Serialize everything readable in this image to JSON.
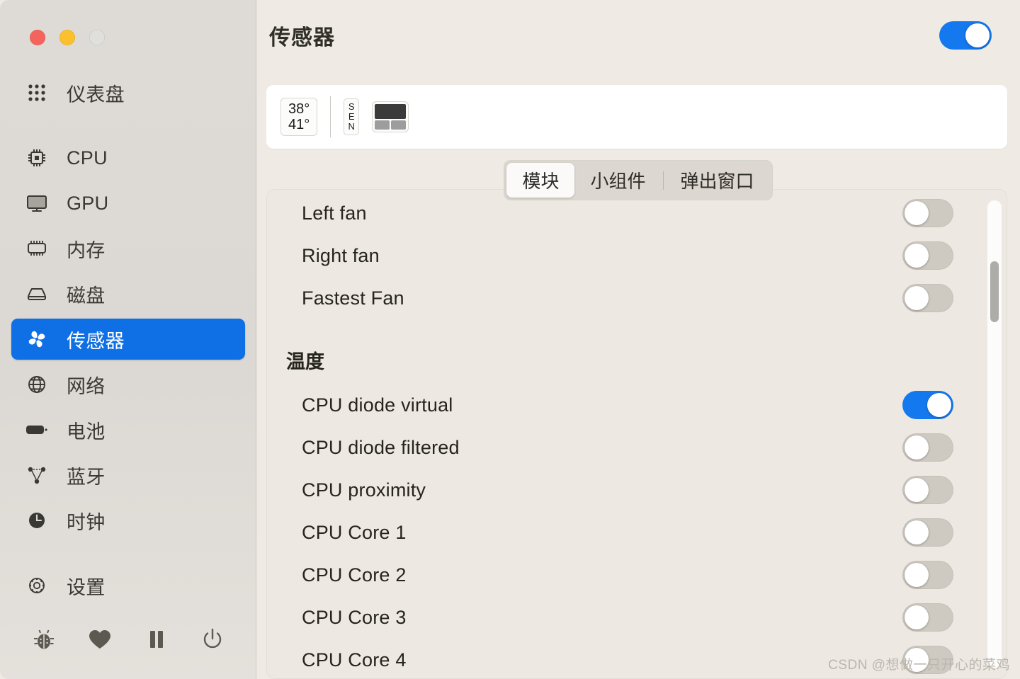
{
  "window": {
    "traffic_lights": [
      {
        "name": "close",
        "color": "#F4635C"
      },
      {
        "name": "minimize",
        "color": "#FBC02D"
      },
      {
        "name": "zoom",
        "color": "#DFDFDC"
      }
    ]
  },
  "sidebar": {
    "items": [
      {
        "label": "仪表盘",
        "icon": "dashboard-grid-icon",
        "selected": false
      },
      {
        "label": "CPU",
        "icon": "cpu-chip-icon",
        "selected": false
      },
      {
        "label": "GPU",
        "icon": "monitor-icon",
        "selected": false
      },
      {
        "label": "内存",
        "icon": "memory-chip-icon",
        "selected": false
      },
      {
        "label": "磁盘",
        "icon": "disk-icon",
        "selected": false
      },
      {
        "label": "传感器",
        "icon": "fan-icon",
        "selected": true
      },
      {
        "label": "网络",
        "icon": "globe-icon",
        "selected": false
      },
      {
        "label": "电池",
        "icon": "battery-icon",
        "selected": false
      },
      {
        "label": "蓝牙",
        "icon": "bluetooth-nodes-icon",
        "selected": false
      },
      {
        "label": "时钟",
        "icon": "clock-icon",
        "selected": false
      },
      {
        "label": "设置",
        "icon": "gear-icon",
        "selected": false
      }
    ],
    "tools": [
      {
        "name": "report-bug-icon"
      },
      {
        "name": "heart-icon"
      },
      {
        "name": "pause-icon"
      },
      {
        "name": "power-icon"
      }
    ]
  },
  "header": {
    "title": "传感器",
    "master_toggle": {
      "state": "on",
      "color": "#1478EE"
    }
  },
  "preview": {
    "temperature_lines": [
      "38°",
      "41°"
    ],
    "sen_label_letters": [
      "S",
      "E",
      "N"
    ],
    "block_widget": {
      "name": "bar-chart-widget",
      "top_color": "#3B3B3B",
      "cell_color": "#9D9D9D"
    }
  },
  "tabs": [
    {
      "label": "模块",
      "active": true
    },
    {
      "label": "小组件",
      "active": false
    },
    {
      "label": "弹出窗口",
      "active": false
    }
  ],
  "list": {
    "fans": [
      {
        "label": "Left fan",
        "toggle": "off",
        "clipped": true
      },
      {
        "label": "Right fan",
        "toggle": "off"
      },
      {
        "label": "Fastest Fan",
        "toggle": "off"
      }
    ],
    "temperature_section_title": "温度",
    "temperatures": [
      {
        "label": "CPU diode virtual",
        "toggle": "on"
      },
      {
        "label": "CPU diode filtered",
        "toggle": "off"
      },
      {
        "label": "CPU proximity",
        "toggle": "off"
      },
      {
        "label": "CPU Core 1",
        "toggle": "off"
      },
      {
        "label": "CPU Core 2",
        "toggle": "off"
      },
      {
        "label": "CPU Core 3",
        "toggle": "off"
      },
      {
        "label": "CPU Core 4",
        "toggle": "off"
      }
    ]
  },
  "scrollbar": {
    "thumb_top_pct": 13,
    "thumb_height_pct": 13
  },
  "watermark": "CSDN @想做一只开心的菜鸡",
  "colors": {
    "accent_blue": "#0F6FE5",
    "toggle_blue": "#1478EE",
    "sidebar_bg": "#DCD8D3",
    "main_bg": "#EFEBE4",
    "card_bg": "#EDE9E2",
    "text": "#26241F"
  }
}
